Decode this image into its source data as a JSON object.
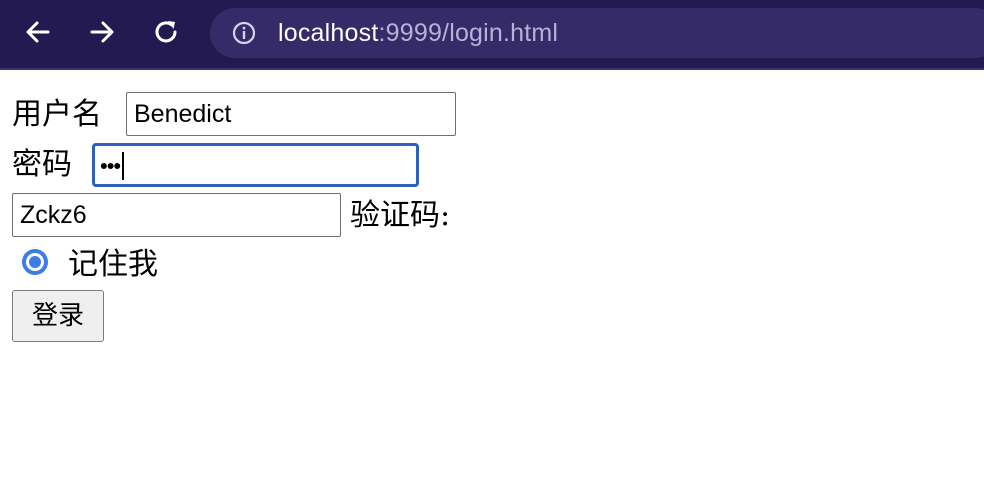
{
  "browser": {
    "url_host": "localhost",
    "url_rest": ":9999/login.html",
    "icons": {
      "back": "arrow-left",
      "forward": "arrow-right",
      "reload": "refresh",
      "site_info": "info-circle"
    }
  },
  "form": {
    "username_label": "用户名",
    "username_value": "Benedict",
    "password_label": "密码",
    "password_mask": "•••",
    "captcha_value": "Zckz6",
    "captcha_label": "验证码:",
    "remember_label": "记住我",
    "remember_checked": true,
    "login_button": "登录"
  },
  "colors": {
    "topbar": "#231a52",
    "omnibox": "#352b68",
    "focus_border": "#2f5fbf",
    "radio_accent": "#3b7ce6"
  }
}
